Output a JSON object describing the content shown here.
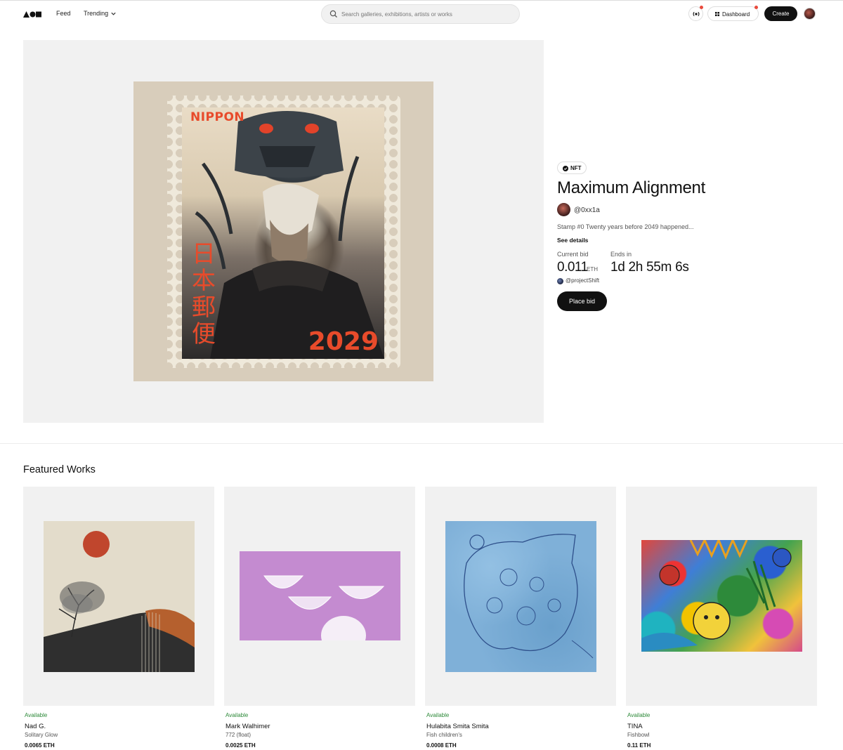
{
  "nav": {
    "feed": "Feed",
    "trending": "Trending",
    "search_placeholder": "Search galleries, exhibitions, artists or works",
    "dashboard": "Dashboard",
    "create": "Create"
  },
  "hero": {
    "artwork": {
      "stamp_title": "NIPPON",
      "stamp_kanji": "日本郵便",
      "stamp_year": "2029"
    },
    "badge": "NFT",
    "title": "Maximum Alignment",
    "artist": "@0xx1a",
    "description": "Stamp #0 Twenty years before 2049 happened...",
    "see_details": "See details",
    "current_bid_label": "Current bid",
    "current_bid_value": "0.011",
    "current_bid_unit": "ETH",
    "ends_label": "Ends in",
    "ends_value": "1d 2h 55m 6s",
    "bidder": "@projectShift",
    "place_bid": "Place bid"
  },
  "featured": {
    "heading": "Featured Works",
    "cards": [
      {
        "status": "Available",
        "artist": "Nad G.",
        "work": "Solitary Glow",
        "price": "0.0065 ETH"
      },
      {
        "status": "Available",
        "artist": "Mark Walhimer",
        "work": "772 (float)",
        "price": "0.0025 ETH"
      },
      {
        "status": "Available",
        "artist": "Hulabita Smita Smita",
        "work": "Fish children's",
        "price": "0.0008 ETH"
      },
      {
        "status": "Available",
        "artist": "TINA",
        "work": "Fishbowl",
        "price": "0.11 ETH"
      }
    ]
  },
  "colors": {
    "accent": "#111111",
    "available": "#2e8a3a",
    "notification": "#e94a3c",
    "stamp_red": "#e84b2b"
  }
}
